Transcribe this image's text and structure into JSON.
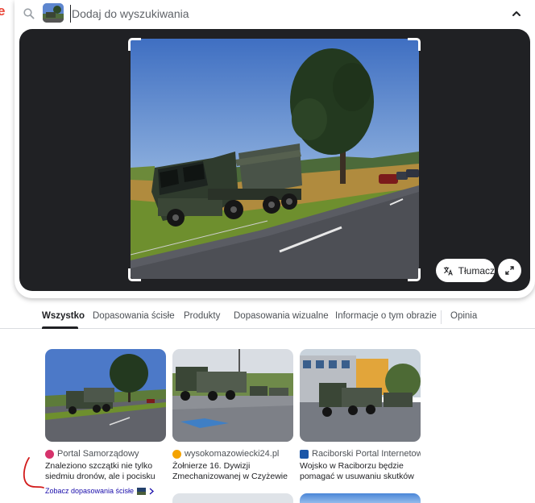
{
  "search": {
    "placeholder": "Dodaj do wyszukiwania",
    "value": ""
  },
  "viewer": {
    "translate_label": "Tłumacz",
    "icons": [
      "search-icon",
      "chevron-up-icon",
      "translate-icon",
      "fullscreen-icon"
    ]
  },
  "tabs": [
    {
      "label": "Wszystko",
      "active": true
    },
    {
      "label": "Dopasowania ścisłe",
      "active": false
    },
    {
      "label": "Produkty",
      "active": false
    },
    {
      "label": "Dopasowania wizualne",
      "active": false
    },
    {
      "label": "Informacje o tym obrazie",
      "active": false
    },
    {
      "label": "Opinia",
      "active": false
    }
  ],
  "results": [
    {
      "source": "Portal Samorządowy",
      "title": "Znaleziono szczątki nie tylko siedmiu dronów, ale i pocisku",
      "more_link": "Zobacz dopasowania ścisłe",
      "favicon_color": "#d6336c"
    },
    {
      "source": "wysokomazowiecki24.pl",
      "title": "Żołnierze 16. Dywizji Zmechanizowanej w Czyżewie ...",
      "favicon_color": "#f4a300"
    },
    {
      "source": "Raciborski Portal Internetowy",
      "title": "Wojsko w Raciborzu będzie pomagać w usuwaniu skutków ...",
      "favicon_color": "#1a56a8"
    }
  ],
  "colors": {
    "accent_text": "#1a0dab",
    "annotation_red": "#d21b1b",
    "viewer_bg": "#202124"
  }
}
